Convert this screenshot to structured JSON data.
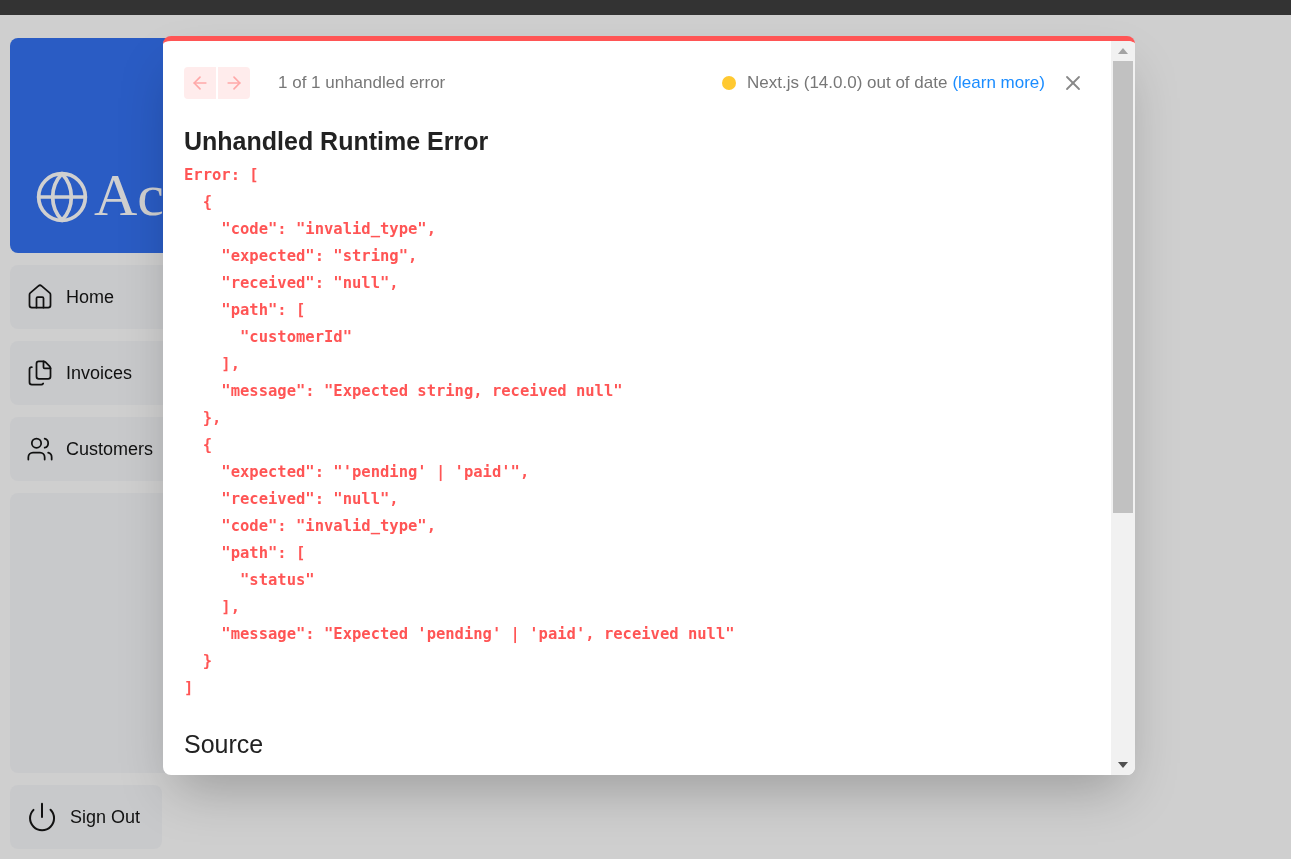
{
  "sidebar": {
    "logo_text": "Ac",
    "items": [
      {
        "kind": "home",
        "label": "Home"
      },
      {
        "kind": "docs",
        "label": "Invoices"
      },
      {
        "kind": "users",
        "label": "Customers"
      }
    ],
    "sign_out": "Sign Out"
  },
  "dialog": {
    "pager": "1 of 1 unhandled error",
    "version_status": {
      "color": "#ffc931",
      "text": "Next.js (14.0.0) out of date",
      "link": "(learn more)"
    },
    "title": "Unhandled Runtime Error",
    "error_lines": [
      "Error: [",
      "  {",
      "    \"code\": \"invalid_type\",",
      "    \"expected\": \"string\",",
      "    \"received\": \"null\",",
      "    \"path\": [",
      "      \"customerId\"",
      "    ],",
      "    \"message\": \"Expected string, received null\"",
      "  },",
      "  {",
      "    \"expected\": \"'pending' | 'paid'\",",
      "    \"received\": \"null\",",
      "    \"code\": \"invalid_type\",",
      "    \"path\": [",
      "      \"status\"",
      "    ],",
      "    \"message\": \"Expected 'pending' | 'paid', received null\"",
      "  }",
      "]"
    ],
    "section_heading": "Source"
  }
}
